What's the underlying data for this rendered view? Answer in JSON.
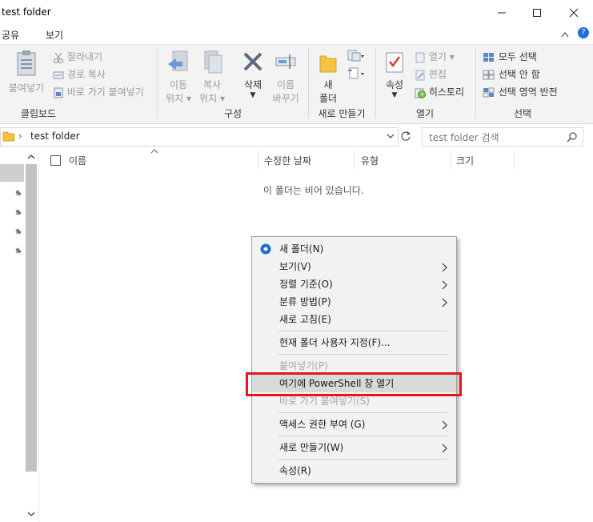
{
  "window": {
    "title": "test folder",
    "minimize": "—",
    "maximize": "☐",
    "close": "✕"
  },
  "ribbon_tabs": {
    "share": "공유",
    "view": "보기",
    "help_chevron": "^",
    "help": "?"
  },
  "ribbon": {
    "clipboard": {
      "paste": "붙여넣기",
      "cut": "잘라내기",
      "copy_path": "경로 복사",
      "paste_shortcut": "바로 가기 붙여넣기",
      "group": "클립보드"
    },
    "organize": {
      "move_to": [
        "이동",
        "위치"
      ],
      "copy_to": [
        "복사",
        "위치"
      ],
      "delete": "삭제",
      "rename": [
        "이름",
        "바꾸기"
      ],
      "group": "구성"
    },
    "new": {
      "new_folder": [
        "새",
        "폴더"
      ],
      "group": "새로 만들기"
    },
    "open": {
      "properties": "속성",
      "open": "열기",
      "edit": "편집",
      "history": "히스토리",
      "group": "열기"
    },
    "select": {
      "select_all": "모두 선택",
      "select_none": "선택 안 함",
      "invert": "선택 영역 반전",
      "group": "선택"
    }
  },
  "address": {
    "path": "test folder",
    "search_placeholder": "test folder 검색"
  },
  "columns": {
    "name": "이름",
    "date": "수정한 날짜",
    "type": "유형",
    "size": "크기"
  },
  "empty_message": "이 폴더는 비어 있습니다.",
  "context_menu": {
    "new_folder": "새 폴더(N)",
    "view": "보기(V)",
    "sort": "정렬 기준(O)",
    "group_by": "분류 방법(P)",
    "refresh": "새로 고침(E)",
    "customize": "현재 폴더 사용자 지정(F)...",
    "paste": "붙여넣기(P)",
    "powershell": "여기에 PowerShell 창 열기",
    "paste_shortcut": "바로 가기 붙여넣기(S)",
    "give_access": "액세스 권한 부여 (G)",
    "new": "새로 만들기(W)",
    "properties": "속성(R)",
    "submenu_arrow": "〉"
  },
  "colors": {
    "highlight_box": "#e3161b",
    "accent_blue": "#1e6fd6",
    "folder_yellow": "#f5c342"
  }
}
